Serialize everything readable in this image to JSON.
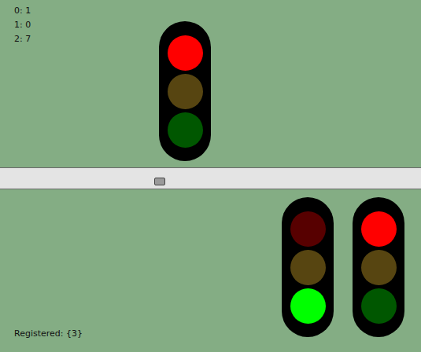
{
  "counters": [
    "0: 1",
    "1: 0",
    "2: 7"
  ],
  "top_lights": [
    {
      "lamps": [
        {
          "name": "red",
          "on": true,
          "color": "#ff0000"
        },
        {
          "name": "amber",
          "on": false,
          "color": "#ffcc33"
        },
        {
          "name": "green",
          "on": false,
          "color": "#00ff00"
        }
      ]
    }
  ],
  "road": {
    "cars": 1
  },
  "bottom_lights": [
    {
      "lamps": [
        {
          "name": "red",
          "on": false,
          "color": "#ff0000"
        },
        {
          "name": "amber",
          "on": false,
          "color": "#ffcc33"
        },
        {
          "name": "green",
          "on": true,
          "color": "#00ff00"
        }
      ]
    },
    {
      "lamps": [
        {
          "name": "red",
          "on": true,
          "color": "#ff0000"
        },
        {
          "name": "amber",
          "on": false,
          "color": "#ffcc33"
        },
        {
          "name": "green",
          "on": false,
          "color": "#00ff00"
        }
      ]
    }
  ],
  "status": "Registered: {3}"
}
